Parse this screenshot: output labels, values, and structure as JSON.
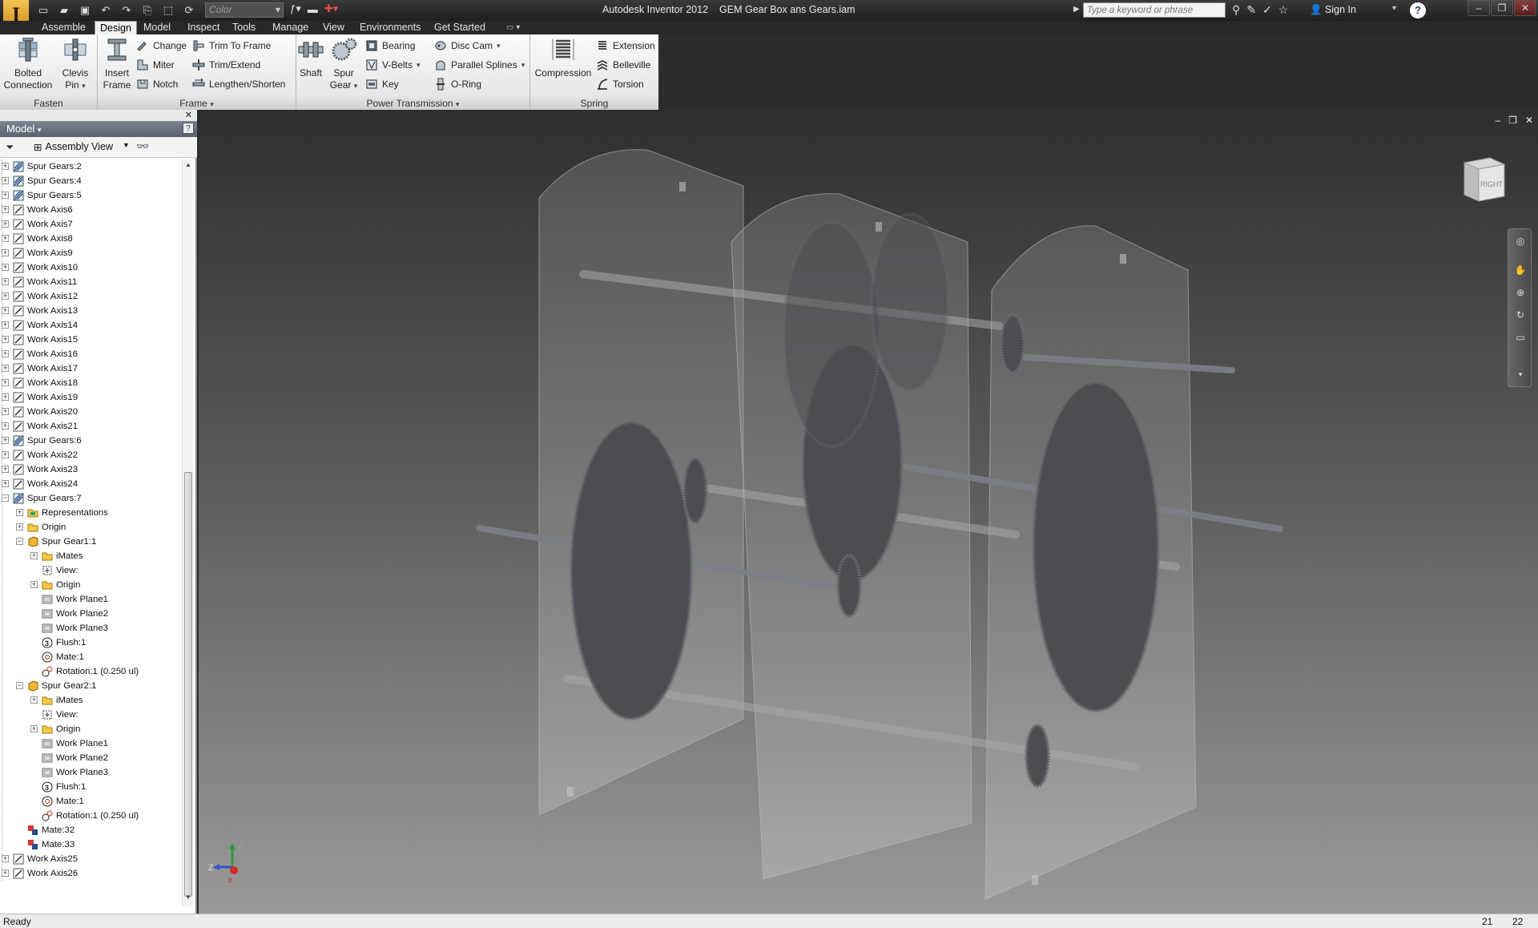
{
  "titlebar": {
    "app_name": "Autodesk Inventor 2012",
    "document": "GEM Gear Box ans Gears.iam",
    "color_combo": "Color",
    "search_placeholder": "Type a keyword or phrase",
    "sign_in": "Sign In"
  },
  "tabs": [
    "Assemble",
    "Design",
    "Model",
    "Inspect",
    "Tools",
    "Manage",
    "View",
    "Environments",
    "Get Started"
  ],
  "active_tab": "Design",
  "ribbon": {
    "fasten": {
      "title": "Fasten",
      "bolted_line1": "Bolted",
      "bolted_line2": "Connection",
      "clevis_line1": "Clevis",
      "clevis_line2": "Pin"
    },
    "frame": {
      "title": "Frame",
      "insert_line1": "Insert",
      "insert_line2": "Frame",
      "change": "Change",
      "miter": "Miter",
      "notch": "Notch",
      "trim_to_frame": "Trim To Frame",
      "trim_extend": "Trim/Extend",
      "lengthen_shorten": "Lengthen/Shorten"
    },
    "power": {
      "title": "Power Transmission",
      "shaft": "Shaft",
      "spur_line1": "Spur",
      "spur_line2": "Gear",
      "bearing": "Bearing",
      "vbelts": "V-Belts",
      "key": "Key",
      "disc_cam": "Disc Cam",
      "parallel_splines": "Parallel Splines",
      "oring": "O-Ring"
    },
    "spring": {
      "title": "Spring",
      "compression": "Compression",
      "extension": "Extension",
      "belleville": "Belleville",
      "torsion": "Torsion"
    }
  },
  "browser": {
    "title": "Model",
    "view_mode": "Assembly View",
    "items": [
      {
        "label": "Spur Gears:2",
        "depth": 0,
        "icon": "spur-gear-icon",
        "expander": "+"
      },
      {
        "label": "Spur Gears:4",
        "depth": 0,
        "icon": "spur-gear-icon",
        "expander": "+"
      },
      {
        "label": "Spur Gears:5",
        "depth": 0,
        "icon": "spur-gear-icon",
        "expander": "+"
      },
      {
        "label": "Work Axis6",
        "depth": 0,
        "icon": "work-axis-icon",
        "expander": "+"
      },
      {
        "label": "Work Axis7",
        "depth": 0,
        "icon": "work-axis-icon",
        "expander": "+"
      },
      {
        "label": "Work Axis8",
        "depth": 0,
        "icon": "work-axis-icon",
        "expander": "+"
      },
      {
        "label": "Work Axis9",
        "depth": 0,
        "icon": "work-axis-icon",
        "expander": "+"
      },
      {
        "label": "Work Axis10",
        "depth": 0,
        "icon": "work-axis-icon",
        "expander": "+"
      },
      {
        "label": "Work Axis11",
        "depth": 0,
        "icon": "work-axis-icon",
        "expander": "+"
      },
      {
        "label": "Work Axis12",
        "depth": 0,
        "icon": "work-axis-icon",
        "expander": "+"
      },
      {
        "label": "Work Axis13",
        "depth": 0,
        "icon": "work-axis-icon",
        "expander": "+"
      },
      {
        "label": "Work Axis14",
        "depth": 0,
        "icon": "work-axis-icon",
        "expander": "+"
      },
      {
        "label": "Work Axis15",
        "depth": 0,
        "icon": "work-axis-icon",
        "expander": "+"
      },
      {
        "label": "Work Axis16",
        "depth": 0,
        "icon": "work-axis-icon",
        "expander": "+"
      },
      {
        "label": "Work Axis17",
        "depth": 0,
        "icon": "work-axis-icon",
        "expander": "+"
      },
      {
        "label": "Work Axis18",
        "depth": 0,
        "icon": "work-axis-icon",
        "expander": "+"
      },
      {
        "label": "Work Axis19",
        "depth": 0,
        "icon": "work-axis-icon",
        "expander": "+"
      },
      {
        "label": "Work Axis20",
        "depth": 0,
        "icon": "work-axis-icon",
        "expander": "+"
      },
      {
        "label": "Work Axis21",
        "depth": 0,
        "icon": "work-axis-icon",
        "expander": "+"
      },
      {
        "label": "Spur Gears:6",
        "depth": 0,
        "icon": "spur-gear-icon",
        "expander": "+"
      },
      {
        "label": "Work Axis22",
        "depth": 0,
        "icon": "work-axis-icon",
        "expander": "+"
      },
      {
        "label": "Work Axis23",
        "depth": 0,
        "icon": "work-axis-icon",
        "expander": "+"
      },
      {
        "label": "Work Axis24",
        "depth": 0,
        "icon": "work-axis-icon",
        "expander": "+"
      },
      {
        "label": "Spur Gears:7",
        "depth": 0,
        "icon": "spur-gear-icon",
        "expander": "-"
      },
      {
        "label": "Representations",
        "depth": 1,
        "icon": "representations-icon",
        "expander": "+"
      },
      {
        "label": "Origin",
        "depth": 1,
        "icon": "folder-icon",
        "expander": "+"
      },
      {
        "label": "Spur Gear1:1",
        "depth": 1,
        "icon": "part-icon",
        "expander": "-"
      },
      {
        "label": "iMates",
        "depth": 2,
        "icon": "folder-icon",
        "expander": "+"
      },
      {
        "label": "View:",
        "depth": 2,
        "icon": "view-rep-icon",
        "expander": ""
      },
      {
        "label": "Origin",
        "depth": 2,
        "icon": "folder-icon",
        "expander": "+"
      },
      {
        "label": "Work Plane1",
        "depth": 2,
        "icon": "work-plane-icon",
        "expander": ""
      },
      {
        "label": "Work Plane2",
        "depth": 2,
        "icon": "work-plane-icon",
        "expander": ""
      },
      {
        "label": "Work Plane3",
        "depth": 2,
        "icon": "work-plane-icon",
        "expander": ""
      },
      {
        "label": "Flush:1",
        "depth": 2,
        "icon": "flush-constraint-icon",
        "expander": ""
      },
      {
        "label": "Mate:1",
        "depth": 2,
        "icon": "mate-constraint-icon",
        "expander": ""
      },
      {
        "label": "Rotation:1 (0.250 ul)",
        "depth": 2,
        "icon": "rotation-constraint-icon",
        "expander": ""
      },
      {
        "label": "Spur Gear2:1",
        "depth": 1,
        "icon": "part-icon",
        "expander": "-"
      },
      {
        "label": "iMates",
        "depth": 2,
        "icon": "folder-icon",
        "expander": "+"
      },
      {
        "label": "View:",
        "depth": 2,
        "icon": "view-rep-icon",
        "expander": ""
      },
      {
        "label": "Origin",
        "depth": 2,
        "icon": "folder-icon",
        "expander": "+"
      },
      {
        "label": "Work Plane1",
        "depth": 2,
        "icon": "work-plane-icon",
        "expander": ""
      },
      {
        "label": "Work Plane2",
        "depth": 2,
        "icon": "work-plane-icon",
        "expander": ""
      },
      {
        "label": "Work Plane3",
        "depth": 2,
        "icon": "work-plane-icon",
        "expander": ""
      },
      {
        "label": "Flush:1",
        "depth": 2,
        "icon": "flush-constraint-icon",
        "expander": ""
      },
      {
        "label": "Mate:1",
        "depth": 2,
        "icon": "mate-constraint-icon",
        "expander": ""
      },
      {
        "label": "Rotation:1 (0.250 ul)",
        "depth": 2,
        "icon": "rotation-constraint-icon",
        "expander": ""
      },
      {
        "label": "Mate:32",
        "depth": 1,
        "icon": "mate-assembly-icon",
        "expander": ""
      },
      {
        "label": "Mate:33",
        "depth": 1,
        "icon": "mate-assembly-icon",
        "expander": ""
      },
      {
        "label": "Work Axis25",
        "depth": 0,
        "icon": "work-axis-icon",
        "expander": "+"
      },
      {
        "label": "Work Axis26",
        "depth": 0,
        "icon": "work-axis-icon",
        "expander": "+"
      }
    ]
  },
  "viewport": {
    "viewcube_face": "RIGHT",
    "triad": {
      "z": "Z",
      "y": "Y",
      "x": "X"
    }
  },
  "statusbar": {
    "text": "Ready",
    "n1": "21",
    "n2": "22"
  },
  "colors": {
    "accent_gold": "#e3a632",
    "viewport_top": "#2f2f2f",
    "viewport_bottom": "#9a9a9a"
  }
}
